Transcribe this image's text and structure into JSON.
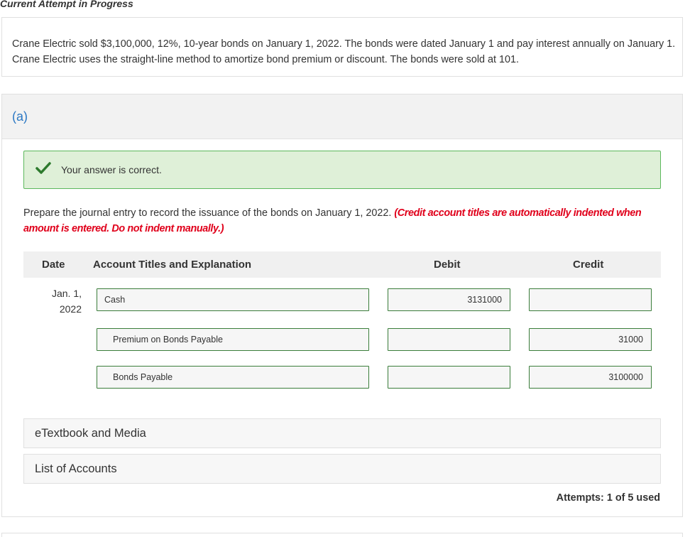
{
  "header": {
    "title": "Current Attempt in Progress"
  },
  "question": {
    "text": "Crane Electric sold $3,100,000, 12%, 10-year bonds on January 1, 2022. The bonds were dated January 1 and pay interest annually on January 1. Crane Electric uses the straight-line method to amortize bond premium or discount. The bonds were sold at 101."
  },
  "part": {
    "label": "(a)",
    "feedback": {
      "status": "correct",
      "message": "Your answer is correct.",
      "icon": "check-icon",
      "color": "#5cb85c"
    },
    "instructions": "Prepare the journal entry to record the issuance of the bonds on January 1, 2022.",
    "note": "(Credit account titles are automatically indented when amount is entered. Do not indent manually.)",
    "note_color": "#e0001b"
  },
  "journal": {
    "headers": {
      "date": "Date",
      "account": "Account Titles and Explanation",
      "debit": "Debit",
      "credit": "Credit"
    },
    "date_line1": "Jan. 1,",
    "date_line2": "2022",
    "rows": [
      {
        "account": "Cash",
        "debit": "3131000",
        "credit": ""
      },
      {
        "account": "Premium on Bonds Payable",
        "debit": "",
        "credit": "31000"
      },
      {
        "account": "Bonds Payable",
        "debit": "",
        "credit": "3100000"
      }
    ]
  },
  "links": {
    "etextbook": "eTextbook and Media",
    "accounts": "List of Accounts"
  },
  "attempts": {
    "text": "Attempts: 1 of 5 used"
  }
}
